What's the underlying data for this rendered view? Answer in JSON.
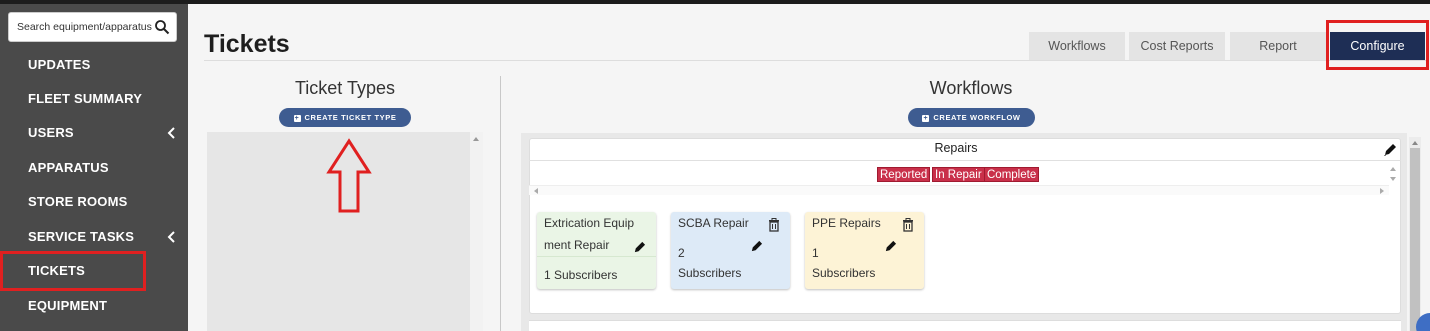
{
  "sidebar": {
    "search_placeholder": "Search equipment/apparatus",
    "items": [
      {
        "label": "UPDATES"
      },
      {
        "label": "FLEET SUMMARY"
      },
      {
        "label": "USERS"
      },
      {
        "label": "APPARATUS"
      },
      {
        "label": "STORE ROOMS"
      },
      {
        "label": "SERVICE TASKS"
      },
      {
        "label": "TICKETS"
      },
      {
        "label": "EQUIPMENT"
      }
    ]
  },
  "header": {
    "title": "Tickets",
    "tabs": [
      "Workflows",
      "Cost Reports",
      "Report",
      "Configure"
    ]
  },
  "ticket_types": {
    "title": "Ticket Types",
    "create_label": "CREATE TICKET TYPE"
  },
  "workflows": {
    "title": "Workflows",
    "create_label": "CREATE WORKFLOW",
    "workflow": {
      "name": "Repairs",
      "statuses": [
        "Reported",
        "In Repair",
        "Complete"
      ]
    },
    "tickets": [
      {
        "name_line1": "Extrication Equip",
        "name_line2": "ment Repair",
        "subs_line1": "1 Subscribers",
        "subs_line2": ""
      },
      {
        "name_line1": "SCBA Repair",
        "name_line2": "",
        "subs_line1": "2",
        "subs_line2": "Subscribers"
      },
      {
        "name_line1": "PPE Repairs",
        "name_line2": "",
        "subs_line1": "1",
        "subs_line2": "Subscribers"
      }
    ]
  },
  "colors": {
    "sidebar_bg": "#4a4a4a",
    "primary_button": "#1e2e55",
    "pill_button": "#3e5c91",
    "status_chip": "#c9304a",
    "highlight": "#e02020",
    "ticket_green": "#eaf5e6",
    "ticket_blue": "#ddeaf7",
    "ticket_yellow": "#fdf3d6"
  }
}
